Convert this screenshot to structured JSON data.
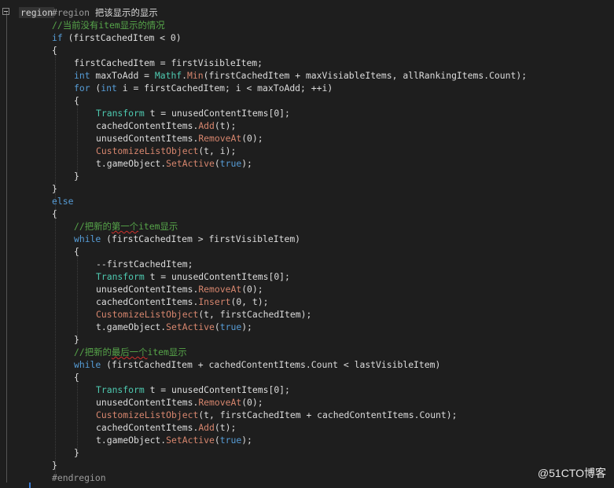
{
  "editor": {
    "fold_label": "region",
    "lines": [
      [
        [
          "pp",
          "#region "
        ],
        [
          "",
          "把该显示的显示"
        ]
      ],
      [
        [
          "cm",
          "//当前没有item显示的情况"
        ]
      ],
      [
        [
          "kw",
          "if"
        ],
        [
          "",
          " (firstCachedItem < 0)"
        ]
      ],
      [
        [
          "",
          "{"
        ]
      ],
      [
        [
          "",
          "firstCachedItem = firstVisibleItem;"
        ]
      ],
      [
        [
          "kw",
          "int"
        ],
        [
          "",
          " maxToAdd = "
        ],
        [
          "ty",
          "Mathf"
        ],
        [
          "",
          "."
        ],
        [
          "mt",
          "Min"
        ],
        [
          "",
          "(firstCachedItem + maxVisiableItems, allRankingItems.Count);"
        ]
      ],
      [
        [
          "kw",
          "for"
        ],
        [
          "",
          " ("
        ],
        [
          "kw",
          "int"
        ],
        [
          "",
          " i = firstCachedItem; i < maxToAdd; ++i)"
        ]
      ],
      [
        [
          "",
          "{"
        ]
      ],
      [
        [
          "ty",
          "Transform"
        ],
        [
          "",
          " t = unusedContentItems[0];"
        ]
      ],
      [
        [
          "",
          "cachedContentItems."
        ],
        [
          "mt",
          "Add"
        ],
        [
          "",
          "(t);"
        ]
      ],
      [
        [
          "",
          "unusedContentItems."
        ],
        [
          "mt",
          "RemoveAt"
        ],
        [
          "",
          "(0);"
        ]
      ],
      [
        [
          "mt",
          "CustomizeListObject"
        ],
        [
          "",
          "(t, i);"
        ]
      ],
      [
        [
          "",
          "t.gameObject."
        ],
        [
          "mt",
          "SetActive"
        ],
        [
          "",
          "("
        ],
        [
          "kw",
          "true"
        ],
        [
          "",
          ");"
        ]
      ],
      [
        [
          "",
          "}"
        ]
      ],
      [
        [
          "",
          "}"
        ]
      ],
      [
        [
          "kw",
          "else"
        ]
      ],
      [
        [
          "",
          "{"
        ]
      ],
      [
        [
          "cm",
          "//把新的"
        ],
        [
          "cmsq",
          "第一个"
        ],
        [
          "cm",
          "item显示"
        ]
      ],
      [
        [
          "kw",
          "while"
        ],
        [
          "",
          " (firstCachedItem > firstVisibleItem)"
        ]
      ],
      [
        [
          "",
          "{"
        ]
      ],
      [
        [
          "",
          "--firstCachedItem;"
        ]
      ],
      [
        [
          "ty",
          "Transform"
        ],
        [
          "",
          " t = unusedContentItems[0];"
        ]
      ],
      [
        [
          "",
          "unusedContentItems."
        ],
        [
          "mt",
          "RemoveAt"
        ],
        [
          "",
          "(0);"
        ]
      ],
      [
        [
          "",
          "cachedContentItems."
        ],
        [
          "mt",
          "Insert"
        ],
        [
          "",
          "(0, t);"
        ]
      ],
      [
        [
          "mt",
          "CustomizeListObject"
        ],
        [
          "",
          "(t, firstCachedItem);"
        ]
      ],
      [
        [
          "",
          "t.gameObject."
        ],
        [
          "mt",
          "SetActive"
        ],
        [
          "",
          "("
        ],
        [
          "kw",
          "true"
        ],
        [
          "",
          ");"
        ]
      ],
      [
        [
          "",
          "}"
        ]
      ],
      [
        [
          "cm",
          "//把新的"
        ],
        [
          "cmsq",
          "最后一个"
        ],
        [
          "cm",
          "item显示"
        ]
      ],
      [
        [
          "kw",
          "while"
        ],
        [
          "",
          " (firstCachedItem + cachedContentItems.Count < lastVisibleItem)"
        ]
      ],
      [
        [
          "",
          "{"
        ]
      ],
      [
        [
          "ty",
          "Transform"
        ],
        [
          "",
          " t = unusedContentItems[0];"
        ]
      ],
      [
        [
          "",
          "unusedContentItems."
        ],
        [
          "mt",
          "RemoveAt"
        ],
        [
          "",
          "(0);"
        ]
      ],
      [
        [
          "mt",
          "CustomizeListObject"
        ],
        [
          "",
          "(t, firstCachedItem + cachedContentItems.Count);"
        ]
      ],
      [
        [
          "",
          "cachedContentItems."
        ],
        [
          "mt",
          "Add"
        ],
        [
          "",
          "(t);"
        ]
      ],
      [
        [
          "",
          "t.gameObject."
        ],
        [
          "mt",
          "SetActive"
        ],
        [
          "",
          "("
        ],
        [
          "kw",
          "true"
        ],
        [
          "",
          ");"
        ]
      ],
      [
        [
          "",
          "}"
        ]
      ],
      [
        [
          "",
          "}"
        ]
      ],
      [
        [
          "pp",
          "#endregion"
        ]
      ]
    ]
  },
  "watermark": {
    "text": "@51CTO博客"
  },
  "colors": {
    "background": "#1e1e1e",
    "keyword": "#569cd6",
    "type": "#4ec9b0",
    "method": "#d7866e",
    "comment": "#57a64a",
    "preprocessor": "#9b9b9b"
  }
}
